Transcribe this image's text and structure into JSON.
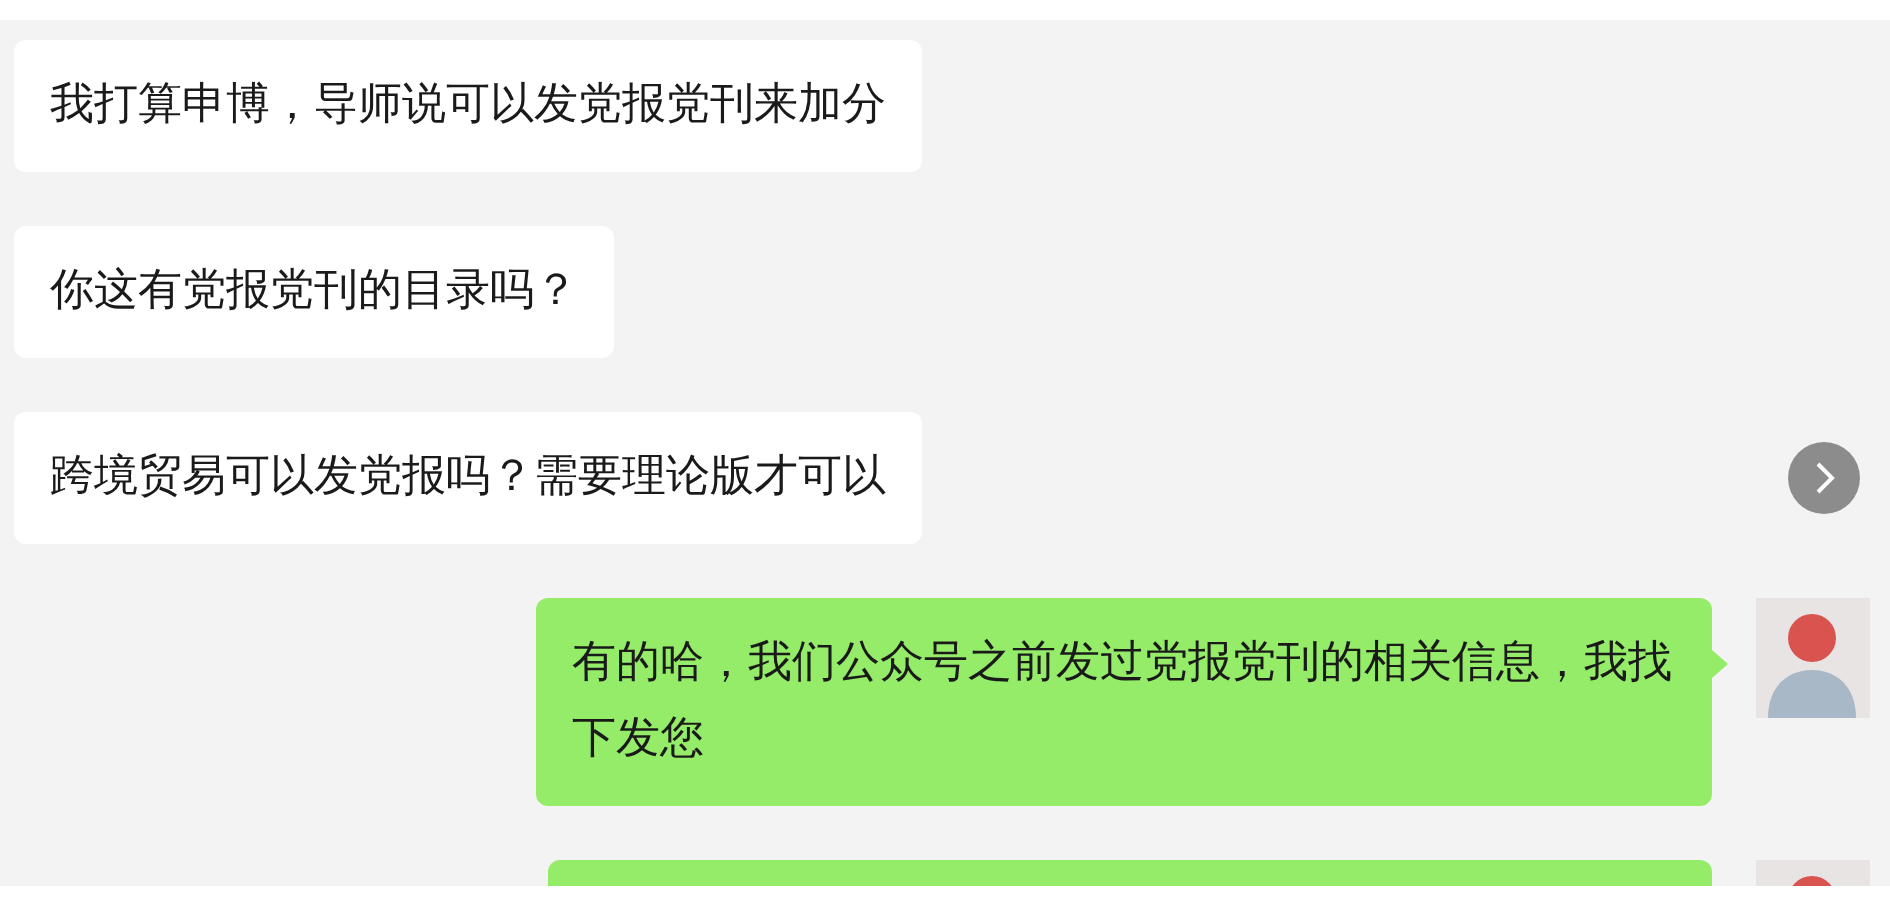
{
  "messages": [
    {
      "kind": "received",
      "text": "我打算申博，导师说可以发党报党刊来加分"
    },
    {
      "kind": "received",
      "text": "你这有党报党刊的目录吗？"
    },
    {
      "kind": "received",
      "text": "跨境贸易可以发党报吗？需要理论版才可以"
    },
    {
      "kind": "sent",
      "text": "有的哈，我们公众号之前发过党报党刊的相关信息，我找下发您"
    },
    {
      "kind": "sent"
    }
  ]
}
